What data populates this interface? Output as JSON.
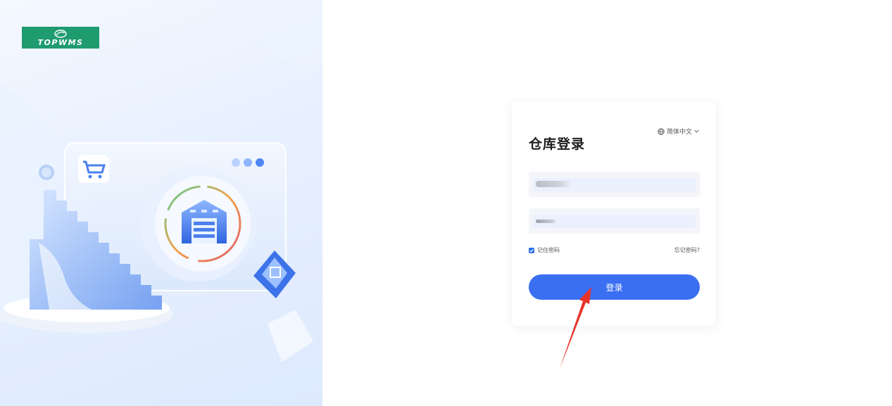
{
  "brand": {
    "logo_text": "TOPWMS",
    "logo_color": "#1f9b70"
  },
  "illustration": {
    "icons": [
      "shopping-cart-icon",
      "warehouse-icon",
      "package-icon"
    ]
  },
  "login_card": {
    "title": "仓库登录",
    "language_label": "简体中文",
    "language_icon": "globe-icon",
    "username_value": "",
    "password_value": "",
    "remember_label": "记住密码",
    "remember_checked": true,
    "forgot_label": "忘记密码?",
    "submit_label": "登录"
  },
  "colors": {
    "accent": "#3a6ff2",
    "annotation": "#e8332b"
  }
}
